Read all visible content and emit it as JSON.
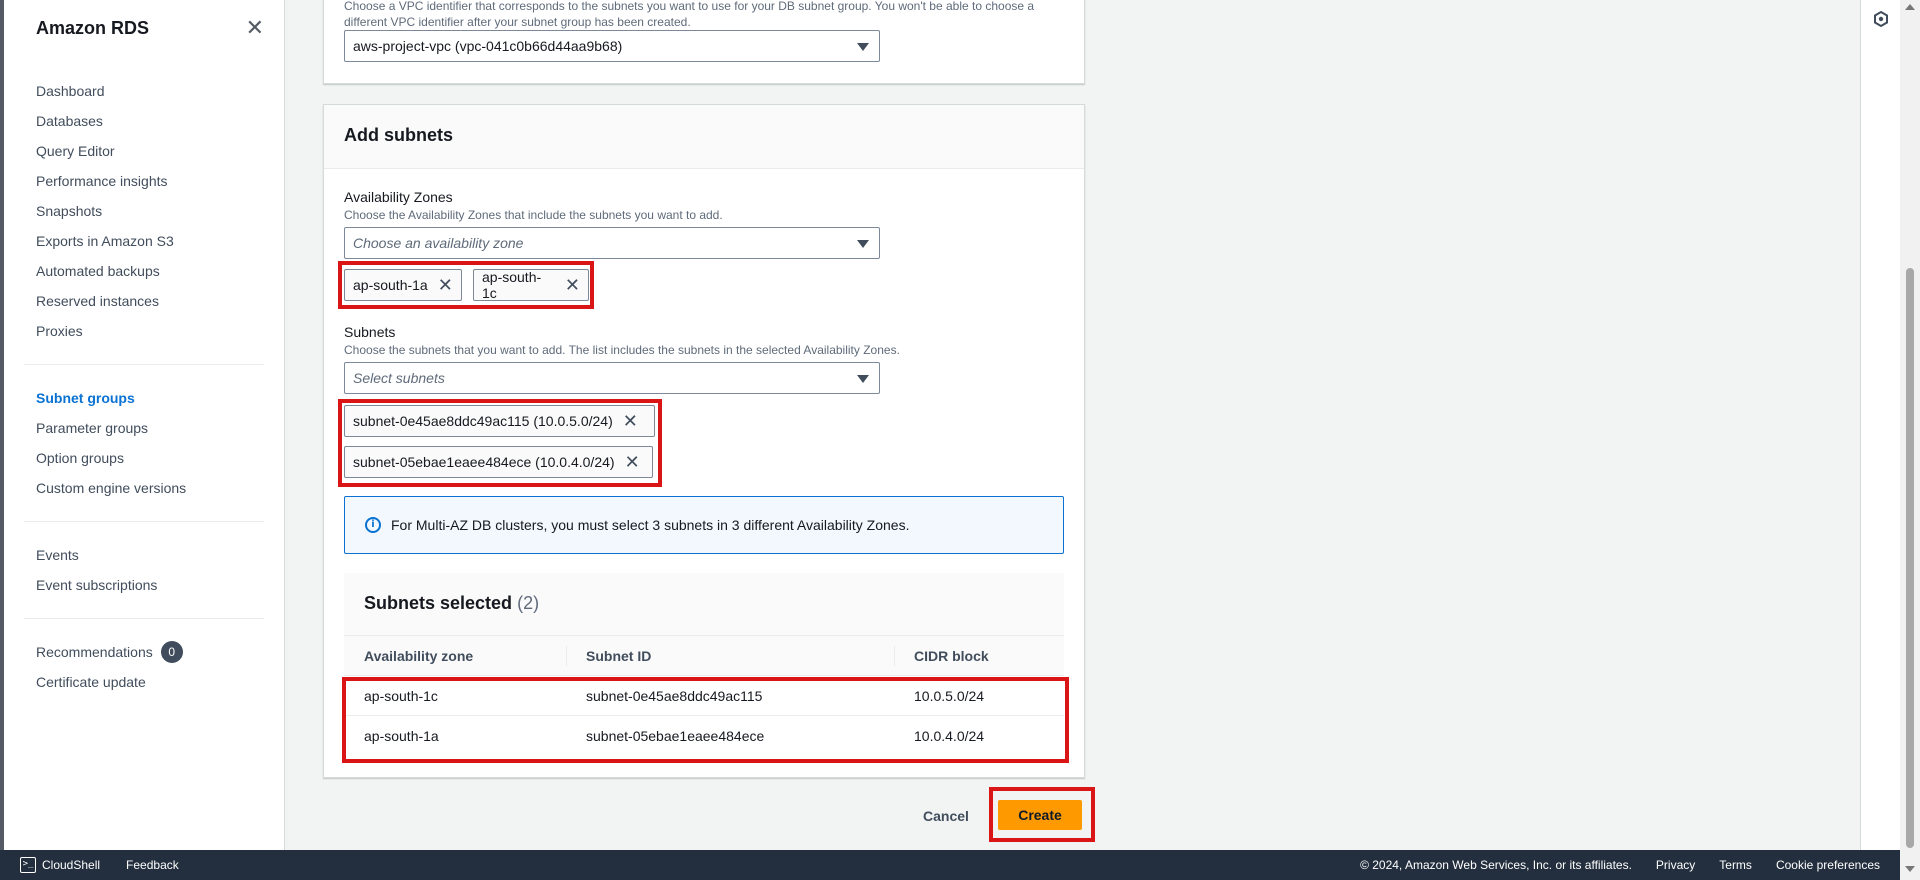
{
  "sidebar": {
    "title": "Amazon RDS",
    "group1": [
      "Dashboard",
      "Databases",
      "Query Editor",
      "Performance insights",
      "Snapshots",
      "Exports in Amazon S3",
      "Automated backups",
      "Reserved instances",
      "Proxies"
    ],
    "group2": [
      "Subnet groups",
      "Parameter groups",
      "Option groups",
      "Custom engine versions"
    ],
    "group3": [
      "Events",
      "Event subscriptions"
    ],
    "recommendations": {
      "label": "Recommendations",
      "count": "0"
    },
    "certificate_update": "Certificate update"
  },
  "vpc": {
    "description": "Choose a VPC identifier that corresponds to the subnets you want to use for your DB subnet group. You won't be able to choose a different VPC identifier after your subnet group has been created.",
    "selected": "aws-project-vpc (vpc-041c0b66d44aa9b68)"
  },
  "add_subnets": {
    "title": "Add subnets",
    "az_label": "Availability Zones",
    "az_desc": "Choose the Availability Zones that include the subnets you want to add.",
    "az_placeholder": "Choose an availability zone",
    "az_tokens": [
      "ap-south-1a",
      "ap-south-1c"
    ],
    "subnets_label": "Subnets",
    "subnets_desc": "Choose the subnets that you want to add. The list includes the subnets in the selected Availability Zones.",
    "subnets_placeholder": "Select subnets",
    "subnet_tokens": [
      "subnet-0e45ae8ddc49ac115 (10.0.5.0/24)",
      "subnet-05ebae1eaee484ece (10.0.4.0/24)"
    ],
    "alert": "For Multi-AZ DB clusters, you must select 3 subnets in 3 different Availability Zones."
  },
  "selected": {
    "title": "Subnets selected",
    "count": "(2)",
    "columns": [
      "Availability zone",
      "Subnet ID",
      "CIDR block"
    ],
    "rows": [
      [
        "ap-south-1c",
        "subnet-0e45ae8ddc49ac115",
        "10.0.5.0/24"
      ],
      [
        "ap-south-1a",
        "subnet-05ebae1eaee484ece",
        "10.0.4.0/24"
      ]
    ]
  },
  "actions": {
    "cancel": "Cancel",
    "create": "Create"
  },
  "footer": {
    "cloudshell": "CloudShell",
    "feedback": "Feedback",
    "copyright": "© 2024, Amazon Web Services, Inc. or its affiliates.",
    "privacy": "Privacy",
    "terms": "Terms",
    "cookie": "Cookie preferences"
  },
  "colors": {
    "accent": "#0972d3",
    "primary_button": "#ff9900",
    "highlight": "#d91515",
    "footer_bg": "#232f3e"
  }
}
